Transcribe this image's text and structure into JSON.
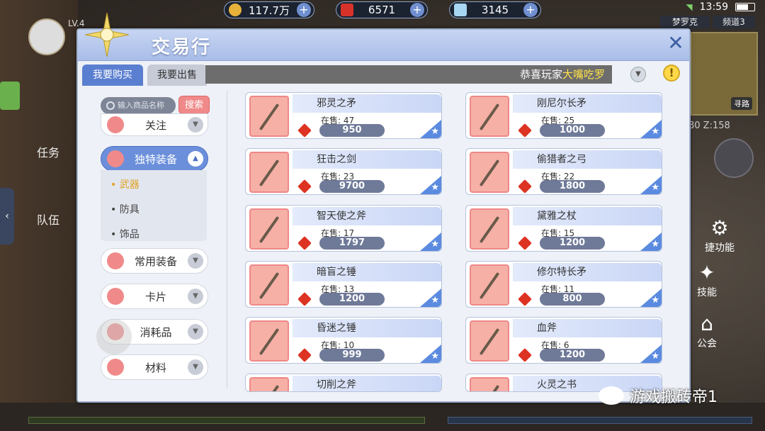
{
  "currency": [
    {
      "value": "117.7万",
      "icon": "coin-icon",
      "color": "#e8b23a"
    },
    {
      "value": "6571",
      "icon": "ruby-icon",
      "color": "#d8322a"
    },
    {
      "value": "3145",
      "icon": "diamond-icon",
      "color": "#a6d6f2"
    }
  ],
  "status": {
    "time": "13:59"
  },
  "hud": {
    "level": "LV.4",
    "task_label": "任务",
    "team_label": "队伍",
    "server_name": "梦罗克",
    "channel": "频道3",
    "find_path": "寻路",
    "coord": "80 Z:158",
    "quick_func": "捷功能",
    "skill": "技能",
    "guild": "公会"
  },
  "panel": {
    "title": "交易行",
    "tab_buy": "我要购买",
    "tab_sell": "我要出售",
    "marquee_prefix": "恭喜玩家",
    "marquee_name": "大嘴吃罗",
    "search_placeholder": "输入商品名称",
    "search_button": "搜索"
  },
  "categories": {
    "follow": "关注",
    "unique": "独特装备",
    "sub_weapon": "武器",
    "sub_armor": "防具",
    "sub_accessory": "饰品",
    "common": "常用装备",
    "card": "卡片",
    "consumable": "消耗品",
    "material": "材料"
  },
  "stock_prefix": "在售: ",
  "items": [
    {
      "name": "邪灵之矛",
      "stock": "47",
      "price": "950"
    },
    {
      "name": "刚尼尔长矛",
      "stock": "25",
      "price": "1000"
    },
    {
      "name": "狂击之剑",
      "stock": "23",
      "price": "9700"
    },
    {
      "name": "偷猎者之弓",
      "stock": "22",
      "price": "1800"
    },
    {
      "name": "智天使之斧",
      "stock": "17",
      "price": "1797"
    },
    {
      "name": "黛雅之杖",
      "stock": "15",
      "price": "1200"
    },
    {
      "name": "暗盲之锤",
      "stock": "13",
      "price": "1200"
    },
    {
      "name": "修尔特长矛",
      "stock": "11",
      "price": "800"
    },
    {
      "name": "昏迷之锤",
      "stock": "10",
      "price": "999"
    },
    {
      "name": "血斧",
      "stock": "6",
      "price": "1200"
    },
    {
      "name": "切削之斧"
    },
    {
      "name": "火灵之书"
    }
  ],
  "watermark": "游戏搬砖帝1"
}
